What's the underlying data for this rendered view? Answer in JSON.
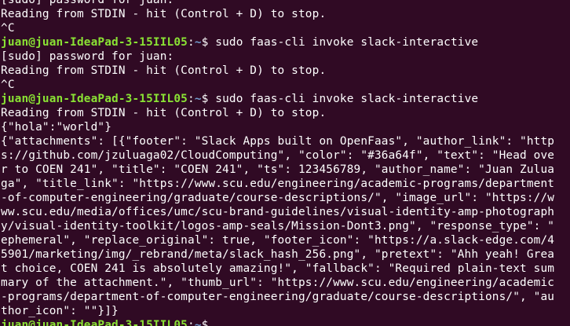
{
  "colors": {
    "background": "#300a24",
    "text": "#ffffff",
    "prompt_user": "#8ae234",
    "prompt_path": "#729fcf"
  },
  "lines": [
    {
      "type": "text",
      "text": "[sudo] password for juan:"
    },
    {
      "type": "text",
      "text": "Reading from STDIN - hit (Control + D) to stop."
    },
    {
      "type": "text",
      "text": "^C"
    },
    {
      "type": "prompt",
      "user": "juan@juan-IdeaPad-3-15IIL05",
      "sep": ":",
      "path": "~",
      "symbol": "$",
      "command": " sudo faas-cli invoke slack-interactive"
    },
    {
      "type": "text",
      "text": "[sudo] password for juan:"
    },
    {
      "type": "text",
      "text": "Reading from STDIN - hit (Control + D) to stop."
    },
    {
      "type": "text",
      "text": "^C"
    },
    {
      "type": "prompt",
      "user": "juan@juan-IdeaPad-3-15IIL05",
      "sep": ":",
      "path": "~",
      "symbol": "$",
      "command": " sudo faas-cli invoke slack-interactive"
    },
    {
      "type": "text",
      "text": "Reading from STDIN - hit (Control + D) to stop."
    },
    {
      "type": "text",
      "text": "{\"hola\":\"world\"}"
    },
    {
      "type": "text",
      "text": "{\"attachments\": [{\"footer\": \"Slack Apps built on OpenFaas\", \"author_link\": \"http"
    },
    {
      "type": "text",
      "text": "s://github.com/jzuluaga02/CloudComputing\", \"color\": \"#36a64f\", \"text\": \"Head ove"
    },
    {
      "type": "text",
      "text": "r to COEN 241\", \"title\": \"COEN 241\", \"ts\": 123456789, \"author_name\": \"Juan Zulua"
    },
    {
      "type": "text",
      "text": "ga\", \"title_link\": \"https://www.scu.edu/engineering/academic-programs/department"
    },
    {
      "type": "text",
      "text": "-of-computer-engineering/graduate/course-descriptions/\", \"image_url\": \"https://w"
    },
    {
      "type": "text",
      "text": "ww.scu.edu/media/offices/umc/scu-brand-guidelines/visual-identity-amp-photograph"
    },
    {
      "type": "text",
      "text": "y/visual-identity-toolkit/logos-amp-seals/Mission-Dont3.png\", \"response_type\": \""
    },
    {
      "type": "text",
      "text": "ephemeral\", \"replace_original\": true, \"footer_icon\": \"https://a.slack-edge.com/4"
    },
    {
      "type": "text",
      "text": "5901/marketing/img/_rebrand/meta/slack_hash_256.png\", \"pretext\": \"Ahh yeah! Grea"
    },
    {
      "type": "text",
      "text": "t choice, COEN 241 is absolutely amazing!\", \"fallback\": \"Required plain-text sum"
    },
    {
      "type": "text",
      "text": "mary of the attachment.\", \"thumb_url\": \"https://www.scu.edu/engineering/academic"
    },
    {
      "type": "text",
      "text": "-programs/department-of-computer-engineering/graduate/course-descriptions/\", \"au"
    },
    {
      "type": "text",
      "text": "thor_icon\": \"\"}]}"
    },
    {
      "type": "prompt",
      "user": "juan@juan-IdeaPad-3-15IIL05",
      "sep": ":",
      "path": "~",
      "symbol": "$",
      "command": ""
    }
  ]
}
